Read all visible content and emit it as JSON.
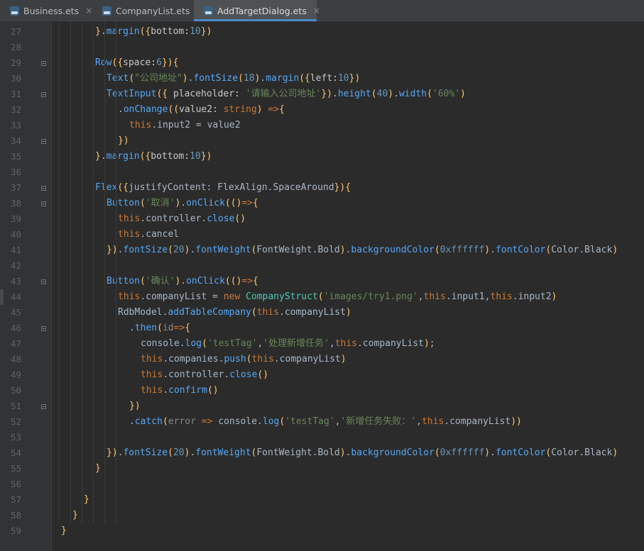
{
  "tabs": [
    {
      "label": "Business.ets",
      "close": "×",
      "active": false
    },
    {
      "label": "CompanyList.ets",
      "close": "×",
      "active": false
    },
    {
      "label": "AddTargetDialog.ets",
      "close": "×",
      "active": true
    }
  ],
  "theme": {
    "default": "#a9b7c6",
    "bracket": "#ffc66d",
    "keyword": "#cc7832",
    "string": "#6a8759",
    "number": "#6897bb",
    "call": "#56a8f5",
    "type": "#4ec9b0",
    "param": "#c8c8c8",
    "muted": "#888888"
  },
  "lines": [
    {
      "n": "27",
      "indent": 3,
      "tokens": [
        [
          "}",
          "bracket"
        ],
        [
          ".",
          "default"
        ],
        [
          "margin",
          "call"
        ],
        [
          "(",
          "bracket"
        ],
        [
          "{",
          "bracket"
        ],
        [
          "bottom:",
          "param"
        ],
        [
          "10",
          "number"
        ],
        [
          "}",
          "bracket"
        ],
        [
          ")",
          "bracket"
        ]
      ]
    },
    {
      "n": "28",
      "indent": 0,
      "tokens": []
    },
    {
      "n": "29",
      "indent": 3,
      "tokens": [
        [
          "Row",
          "call"
        ],
        [
          "(",
          "bracket"
        ],
        [
          "{",
          "bracket"
        ],
        [
          "space:",
          "param"
        ],
        [
          "6",
          "number"
        ],
        [
          "}",
          "bracket"
        ],
        [
          ")",
          "bracket"
        ],
        [
          "{",
          "bracket"
        ]
      ]
    },
    {
      "n": "30",
      "indent": 4,
      "tokens": [
        [
          "Text",
          "call"
        ],
        [
          "(",
          "bracket"
        ],
        [
          "\"公司地址\"",
          "string"
        ],
        [
          ")",
          "bracket"
        ],
        [
          ".",
          "default"
        ],
        [
          "fontSize",
          "call"
        ],
        [
          "(",
          "bracket"
        ],
        [
          "18",
          "number"
        ],
        [
          ")",
          "bracket"
        ],
        [
          ".",
          "default"
        ],
        [
          "margin",
          "call"
        ],
        [
          "(",
          "bracket"
        ],
        [
          "{",
          "bracket"
        ],
        [
          "left:",
          "param"
        ],
        [
          "10",
          "number"
        ],
        [
          "}",
          "bracket"
        ],
        [
          ")",
          "bracket"
        ]
      ]
    },
    {
      "n": "31",
      "indent": 4,
      "tokens": [
        [
          "TextInput",
          "call"
        ],
        [
          "(",
          "bracket"
        ],
        [
          "{ ",
          "bracket"
        ],
        [
          "placeholder: ",
          "param"
        ],
        [
          "'请输入公司地址'",
          "string"
        ],
        [
          "}",
          "bracket"
        ],
        [
          ")",
          "bracket"
        ],
        [
          ".",
          "default"
        ],
        [
          "height",
          "call"
        ],
        [
          "(",
          "bracket"
        ],
        [
          "40",
          "number"
        ],
        [
          ")",
          "bracket"
        ],
        [
          ".",
          "default"
        ],
        [
          "width",
          "call"
        ],
        [
          "(",
          "bracket"
        ],
        [
          "'60%'",
          "string"
        ],
        [
          ")",
          "bracket"
        ]
      ]
    },
    {
      "n": "32",
      "indent": 5,
      "tokens": [
        [
          ".",
          "default"
        ],
        [
          "onChange",
          "call"
        ],
        [
          "(",
          "bracket"
        ],
        [
          "(",
          "bracket"
        ],
        [
          "value2: ",
          "param"
        ],
        [
          "string",
          "keyword"
        ],
        [
          ")",
          "bracket"
        ],
        [
          " =>",
          "keyword"
        ],
        [
          "{",
          "bracket"
        ]
      ]
    },
    {
      "n": "33",
      "indent": 6,
      "tokens": [
        [
          "this",
          "keyword"
        ],
        [
          ".input2 = value2",
          "default"
        ]
      ]
    },
    {
      "n": "34",
      "indent": 5,
      "tokens": [
        [
          "}",
          "bracket"
        ],
        [
          ")",
          "bracket"
        ]
      ]
    },
    {
      "n": "35",
      "indent": 3,
      "tokens": [
        [
          "}",
          "bracket"
        ],
        [
          ".",
          "default"
        ],
        [
          "margin",
          "call"
        ],
        [
          "(",
          "bracket"
        ],
        [
          "{",
          "bracket"
        ],
        [
          "bottom:",
          "param"
        ],
        [
          "10",
          "number"
        ],
        [
          "}",
          "bracket"
        ],
        [
          ")",
          "bracket"
        ]
      ]
    },
    {
      "n": "36",
      "indent": 0,
      "tokens": []
    },
    {
      "n": "37",
      "indent": 3,
      "tokens": [
        [
          "Flex",
          "call"
        ],
        [
          "(",
          "bracket"
        ],
        [
          "{",
          "bracket"
        ],
        [
          "justifyContent: FlexAlign.SpaceAround",
          "default"
        ],
        [
          "}",
          "bracket"
        ],
        [
          ")",
          "bracket"
        ],
        [
          "{",
          "bracket"
        ]
      ]
    },
    {
      "n": "38",
      "indent": 4,
      "tokens": [
        [
          "Button",
          "call"
        ],
        [
          "(",
          "bracket"
        ],
        [
          "'取消'",
          "string"
        ],
        [
          ")",
          "bracket"
        ],
        [
          ".",
          "default"
        ],
        [
          "onClick",
          "call"
        ],
        [
          "(",
          "bracket"
        ],
        [
          "(",
          "bracket"
        ],
        [
          ")",
          "bracket"
        ],
        [
          "=>",
          "keyword"
        ],
        [
          "{",
          "bracket"
        ]
      ]
    },
    {
      "n": "39",
      "indent": 5,
      "tokens": [
        [
          "this",
          "keyword"
        ],
        [
          ".controller.",
          "default"
        ],
        [
          "close",
          "call"
        ],
        [
          "()",
          "bracket"
        ]
      ]
    },
    {
      "n": "40",
      "indent": 5,
      "tokens": [
        [
          "this",
          "keyword"
        ],
        [
          ".cancel",
          "default"
        ]
      ]
    },
    {
      "n": "41",
      "indent": 4,
      "tokens": [
        [
          "}",
          "bracket"
        ],
        [
          ")",
          "bracket"
        ],
        [
          ".",
          "default"
        ],
        [
          "fontSize",
          "call"
        ],
        [
          "(",
          "bracket"
        ],
        [
          "20",
          "number"
        ],
        [
          ")",
          "bracket"
        ],
        [
          ".",
          "default"
        ],
        [
          "fontWeight",
          "call"
        ],
        [
          "(",
          "bracket"
        ],
        [
          "FontWeight.Bold",
          "default"
        ],
        [
          ")",
          "bracket"
        ],
        [
          ".",
          "default"
        ],
        [
          "backgroundColor",
          "call"
        ],
        [
          "(",
          "bracket"
        ],
        [
          "0xffffff",
          "number"
        ],
        [
          ")",
          "bracket"
        ],
        [
          ".",
          "default"
        ],
        [
          "fontColor",
          "call"
        ],
        [
          "(",
          "bracket"
        ],
        [
          "Color.Black",
          "default"
        ],
        [
          ")",
          "bracket"
        ]
      ]
    },
    {
      "n": "42",
      "indent": 0,
      "tokens": []
    },
    {
      "n": "43",
      "indent": 4,
      "tokens": [
        [
          "Button",
          "call"
        ],
        [
          "(",
          "bracket"
        ],
        [
          "'确认'",
          "string"
        ],
        [
          ")",
          "bracket"
        ],
        [
          ".",
          "default"
        ],
        [
          "onClick",
          "call"
        ],
        [
          "(",
          "bracket"
        ],
        [
          "(",
          "bracket"
        ],
        [
          ")",
          "bracket"
        ],
        [
          "=>",
          "keyword"
        ],
        [
          "{",
          "bracket"
        ]
      ]
    },
    {
      "n": "44",
      "indent": 5,
      "tokens": [
        [
          "this",
          "keyword"
        ],
        [
          ".companyList = ",
          "default"
        ],
        [
          "new ",
          "keyword"
        ],
        [
          "CompanyStruct",
          "type"
        ],
        [
          "(",
          "bracket"
        ],
        [
          "'images/try1.png'",
          "string"
        ],
        [
          ",",
          "default"
        ],
        [
          "this",
          "keyword"
        ],
        [
          ".input1,",
          "default"
        ],
        [
          "this",
          "keyword"
        ],
        [
          ".input2",
          "default"
        ],
        [
          ")",
          "bracket"
        ]
      ]
    },
    {
      "n": "45",
      "indent": 5,
      "tokens": [
        [
          "RdbModel.",
          "default"
        ],
        [
          "addTableCompany",
          "call"
        ],
        [
          "(",
          "bracket"
        ],
        [
          "this",
          "keyword"
        ],
        [
          ".companyList",
          "default"
        ],
        [
          ")",
          "bracket"
        ]
      ]
    },
    {
      "n": "46",
      "indent": 6,
      "tokens": [
        [
          ".",
          "default"
        ],
        [
          "then",
          "call"
        ],
        [
          "(",
          "bracket"
        ],
        [
          "id",
          "muted"
        ],
        [
          "=>",
          "keyword"
        ],
        [
          "{",
          "bracket"
        ]
      ]
    },
    {
      "n": "47",
      "indent": 7,
      "tokens": [
        [
          "console.",
          "default"
        ],
        [
          "log",
          "call"
        ],
        [
          "(",
          "bracket"
        ],
        [
          "'testTag'",
          "string"
        ],
        [
          ",",
          "default"
        ],
        [
          "'处理新增任务'",
          "string"
        ],
        [
          ",",
          "default"
        ],
        [
          "this",
          "keyword"
        ],
        [
          ".companyList",
          "default"
        ],
        [
          ")",
          "bracket"
        ],
        [
          ";",
          "default"
        ]
      ]
    },
    {
      "n": "48",
      "indent": 7,
      "tokens": [
        [
          "this",
          "keyword"
        ],
        [
          ".companies.",
          "default"
        ],
        [
          "push",
          "call"
        ],
        [
          "(",
          "bracket"
        ],
        [
          "this",
          "keyword"
        ],
        [
          ".companyList",
          "default"
        ],
        [
          ")",
          "bracket"
        ]
      ]
    },
    {
      "n": "49",
      "indent": 7,
      "tokens": [
        [
          "this",
          "keyword"
        ],
        [
          ".controller.",
          "default"
        ],
        [
          "close",
          "call"
        ],
        [
          "()",
          "bracket"
        ]
      ]
    },
    {
      "n": "50",
      "indent": 7,
      "tokens": [
        [
          "this",
          "keyword"
        ],
        [
          ".",
          "default"
        ],
        [
          "confirm",
          "call"
        ],
        [
          "()",
          "bracket"
        ]
      ]
    },
    {
      "n": "51",
      "indent": 6,
      "tokens": [
        [
          "}",
          "bracket"
        ],
        [
          ")",
          "bracket"
        ]
      ]
    },
    {
      "n": "52",
      "indent": 6,
      "tokens": [
        [
          ".",
          "default"
        ],
        [
          "catch",
          "call"
        ],
        [
          "(",
          "bracket"
        ],
        [
          "error",
          "muted"
        ],
        [
          " => ",
          "keyword"
        ],
        [
          "console.",
          "default"
        ],
        [
          "log",
          "call"
        ],
        [
          "(",
          "bracket"
        ],
        [
          "'testTag'",
          "string"
        ],
        [
          ",",
          "default"
        ],
        [
          "'新增任务失败：'",
          "string"
        ],
        [
          ",",
          "default"
        ],
        [
          "this",
          "keyword"
        ],
        [
          ".companyList",
          "default"
        ],
        [
          ")",
          "bracket"
        ],
        [
          ")",
          "bracket"
        ]
      ]
    },
    {
      "n": "53",
      "indent": 0,
      "tokens": []
    },
    {
      "n": "54",
      "indent": 4,
      "tokens": [
        [
          "}",
          "bracket"
        ],
        [
          ")",
          "bracket"
        ],
        [
          ".",
          "default"
        ],
        [
          "fontSize",
          "call"
        ],
        [
          "(",
          "bracket"
        ],
        [
          "20",
          "number"
        ],
        [
          ")",
          "bracket"
        ],
        [
          ".",
          "default"
        ],
        [
          "fontWeight",
          "call"
        ],
        [
          "(",
          "bracket"
        ],
        [
          "FontWeight.Bold",
          "default"
        ],
        [
          ")",
          "bracket"
        ],
        [
          ".",
          "default"
        ],
        [
          "backgroundColor",
          "call"
        ],
        [
          "(",
          "bracket"
        ],
        [
          "0xffffff",
          "number"
        ],
        [
          ")",
          "bracket"
        ],
        [
          ".",
          "default"
        ],
        [
          "fontColor",
          "call"
        ],
        [
          "(",
          "bracket"
        ],
        [
          "Color.Black",
          "default"
        ],
        [
          ")",
          "bracket"
        ]
      ]
    },
    {
      "n": "55",
      "indent": 3,
      "tokens": [
        [
          "}",
          "bracket"
        ]
      ]
    },
    {
      "n": "56",
      "indent": 0,
      "tokens": []
    },
    {
      "n": "57",
      "indent": 2,
      "tokens": [
        [
          "}",
          "bracket"
        ]
      ]
    },
    {
      "n": "58",
      "indent": 1,
      "tokens": [
        [
          "}",
          "bracket"
        ]
      ]
    },
    {
      "n": "59",
      "indent": 0,
      "tokens": [
        [
          "}",
          "bracket"
        ]
      ]
    }
  ]
}
